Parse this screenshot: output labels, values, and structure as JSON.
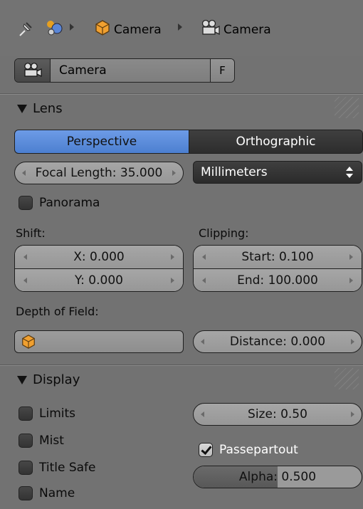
{
  "breadcrumb": {
    "items": [
      {
        "icon": "pin-icon",
        "label": ""
      },
      {
        "icon": "scene-icon",
        "label": ""
      },
      {
        "icon": "object-cube-icon",
        "label": "Camera"
      },
      {
        "icon": "camera-data-icon",
        "label": "Camera"
      }
    ]
  },
  "datablock": {
    "name_value": "Camera",
    "fake_user_label": "F"
  },
  "lens_panel": {
    "title": "Lens",
    "projection": {
      "perspective_label": "Perspective",
      "orthographic_label": "Orthographic",
      "selected": "Perspective"
    },
    "focal_length": "Focal Length: 35.000",
    "lens_unit": "Millimeters",
    "panorama_label": "Panorama",
    "panorama_checked": false,
    "shift_label": "Shift:",
    "shift_x": "X: 0.000",
    "shift_y": "Y: 0.000",
    "clipping_label": "Clipping:",
    "clip_start": "Start: 0.100",
    "clip_end": "End: 100.000",
    "dof_label": "Depth of Field:",
    "dof_distance": "Distance: 0.000"
  },
  "display_panel": {
    "title": "Display",
    "limits_label": "Limits",
    "mist_label": "Mist",
    "title_safe_label": "Title Safe",
    "name_label": "Name",
    "size_value": "Size: 0.50",
    "passepartout_label": "Passepartout",
    "passepartout_checked": true,
    "alpha_value": "Alpha: 0.500",
    "alpha_fraction": 0.5
  },
  "colors": {
    "background": "#727272",
    "selected_toggle": "#5b8ddc",
    "dark_widget": "#333333"
  }
}
